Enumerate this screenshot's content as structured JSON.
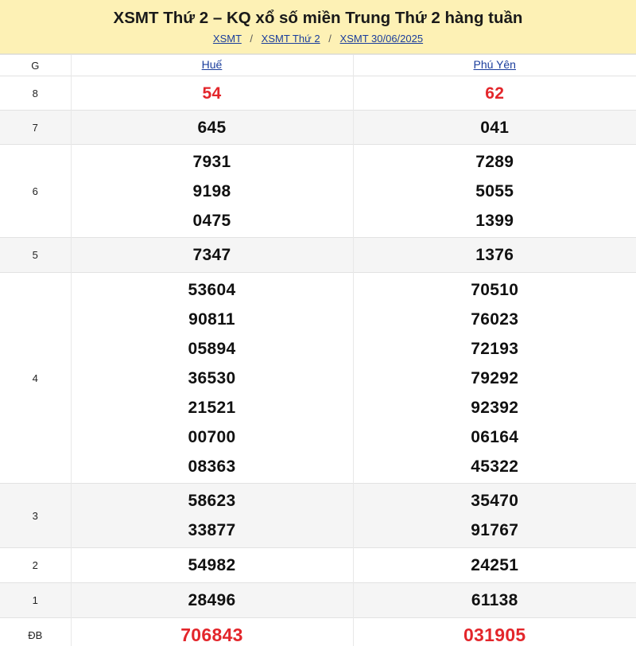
{
  "header": {
    "title": "XSMT Thứ 2 – KQ xổ số miền Trung Thứ 2 hàng tuần",
    "breadcrumb": [
      "XSMT",
      "XSMT Thứ 2",
      "XSMT 30/06/2025"
    ],
    "separator": "/"
  },
  "table": {
    "col_prize": "G",
    "provinces": [
      "Huế",
      "Phú Yên"
    ],
    "rows": [
      {
        "prize": "8",
        "a": [
          "54"
        ],
        "b": [
          "62"
        ]
      },
      {
        "prize": "7",
        "a": [
          "645"
        ],
        "b": [
          "041"
        ]
      },
      {
        "prize": "6",
        "a": [
          "7931",
          "9198",
          "0475"
        ],
        "b": [
          "7289",
          "5055",
          "1399"
        ]
      },
      {
        "prize": "5",
        "a": [
          "7347"
        ],
        "b": [
          "1376"
        ]
      },
      {
        "prize": "4",
        "a": [
          "53604",
          "90811",
          "05894",
          "36530",
          "21521",
          "00700",
          "08363"
        ],
        "b": [
          "70510",
          "76023",
          "72193",
          "79292",
          "92392",
          "06164",
          "45322"
        ]
      },
      {
        "prize": "3",
        "a": [
          "58623",
          "33877"
        ],
        "b": [
          "35470",
          "91767"
        ]
      },
      {
        "prize": "2",
        "a": [
          "54982"
        ],
        "b": [
          "24251"
        ]
      },
      {
        "prize": "1",
        "a": [
          "28496"
        ],
        "b": [
          "61138"
        ]
      },
      {
        "prize": "ĐB",
        "a": [
          "706843"
        ],
        "b": [
          "031905"
        ]
      }
    ]
  },
  "colors": {
    "header_bg": "#fdf1b5",
    "link": "#1a3d9c",
    "highlight_red": "#e3262b",
    "alt_row_bg": "#f5f5f5"
  }
}
